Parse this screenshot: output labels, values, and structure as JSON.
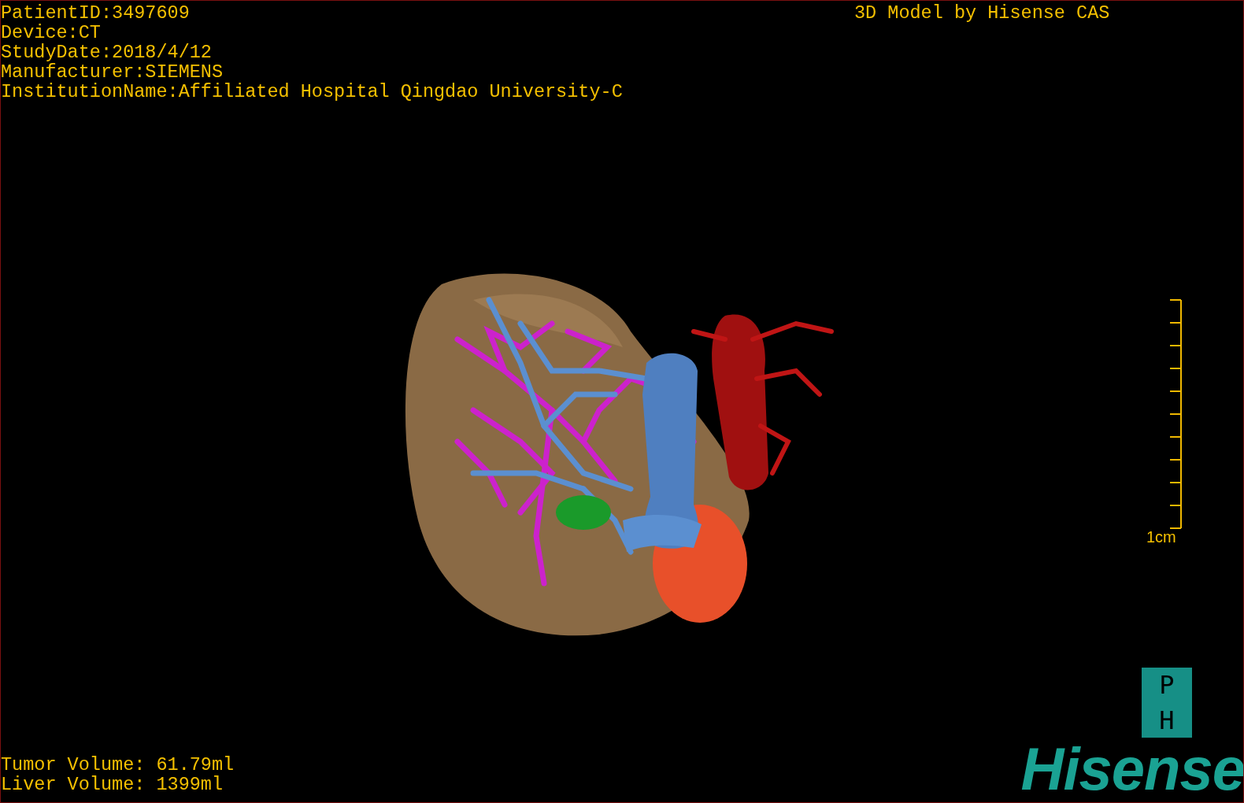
{
  "patient_info": [
    "PatientID:3497609",
    "Device:CT",
    "StudyDate:2018/4/12",
    "Manufacturer:SIEMENS",
    "InstitutionName:Affiliated Hospital Qingdao University-C"
  ],
  "title": "3D Model by Hisense CAS",
  "scale_bar": {
    "label": "1cm"
  },
  "volumes": [
    "Tumor Volume: 61.79ml",
    "Liver Volume: 1399ml"
  ],
  "logo": {
    "badge_letters": [
      "P",
      "H"
    ],
    "wordmark": "Hisense"
  }
}
